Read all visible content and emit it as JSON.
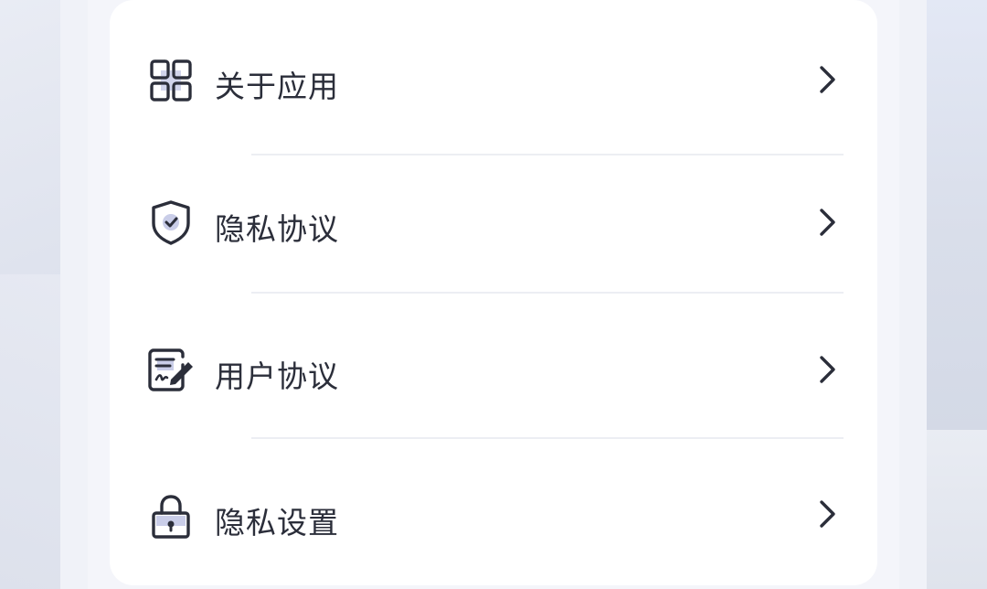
{
  "menu": {
    "items": [
      {
        "label": "关于应用",
        "icon": "grid-apps-icon"
      },
      {
        "label": "隐私协议",
        "icon": "shield-check-icon"
      },
      {
        "label": "用户协议",
        "icon": "document-sign-icon"
      },
      {
        "label": "隐私设置",
        "icon": "lock-icon"
      }
    ]
  },
  "colors": {
    "card": "#ffffff",
    "text": "#2b2e3a",
    "icon_stroke": "#2b2e3a",
    "icon_fill": "#c9cde8",
    "divider": "#eceef3"
  }
}
